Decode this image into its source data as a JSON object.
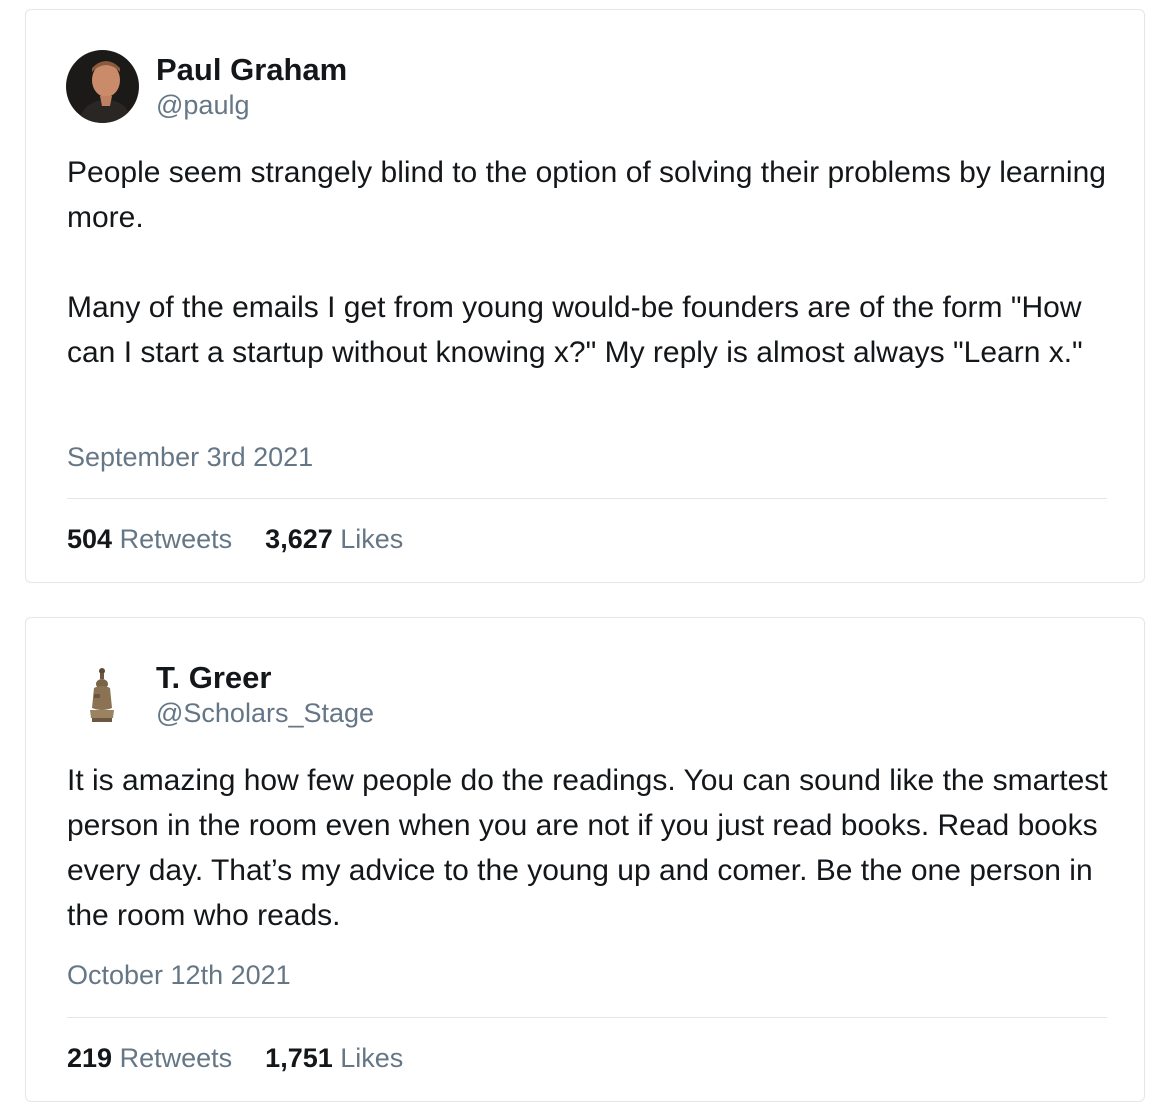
{
  "tweets": [
    {
      "author": {
        "name": "Paul Graham",
        "handle": "@paulg",
        "avatar_icon": "person-photo-avatar"
      },
      "text": [
        "People seem strangely blind to the option of solving their problems by learning more.",
        "Many of the emails I get from young would-be founders are of the form \"How can I start a startup without knowing x?\" My reply is almost always \"Learn x.\""
      ],
      "date": "September 3rd 2021",
      "retweets": "504",
      "retweets_label": "Retweets",
      "likes": "3,627",
      "likes_label": "Likes"
    },
    {
      "author": {
        "name": "T. Greer",
        "handle": "@Scholars_Stage",
        "avatar_icon": "statue-figurine-avatar"
      },
      "text": [
        "It is amazing how few people do the readings. You can sound like the smartest person in the room even when you are not if you just read books. Read books every day. That’s my advice to the young up and comer. Be the one person in the room who reads."
      ],
      "date": "October 12th 2021",
      "retweets": "219",
      "retweets_label": "Retweets",
      "likes": "1,751",
      "likes_label": "Likes"
    }
  ],
  "colors": {
    "text": "#14171a",
    "secondary": "#657786",
    "border": "#e1e8ed"
  }
}
